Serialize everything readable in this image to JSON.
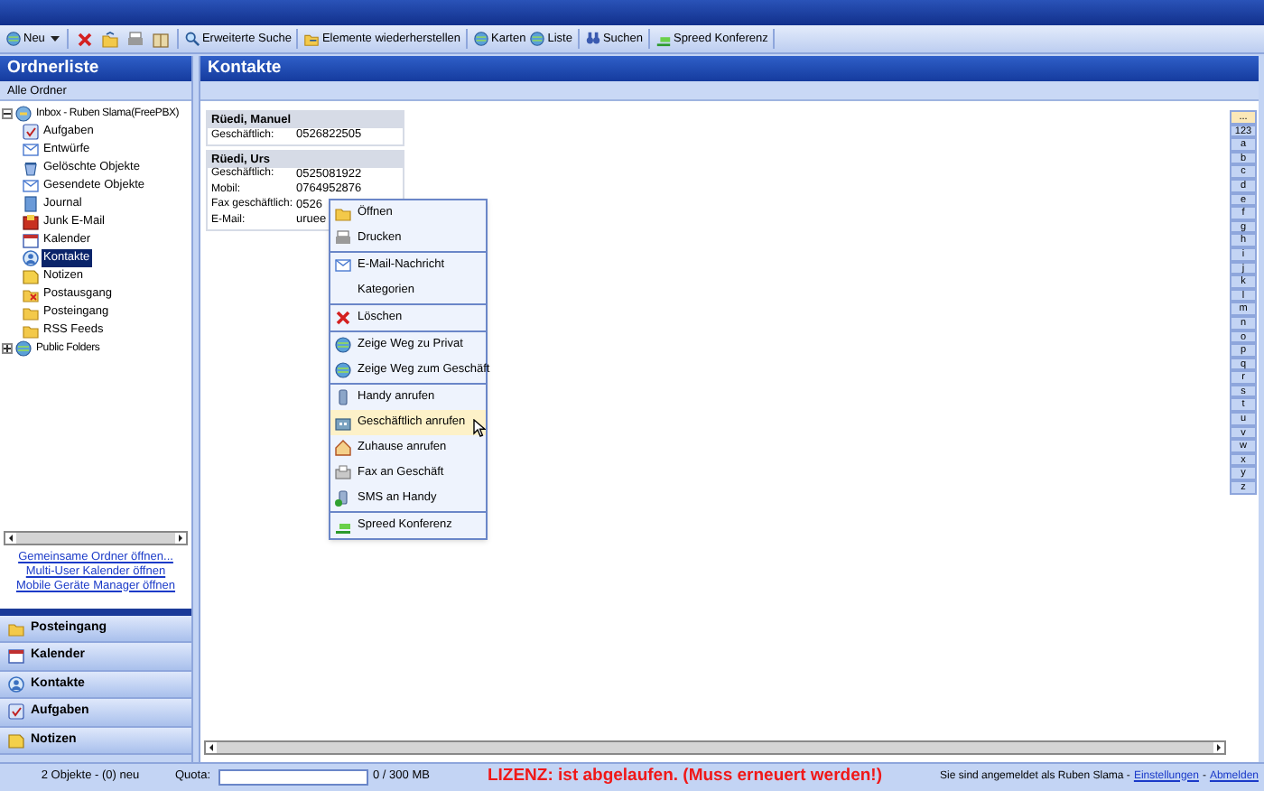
{
  "toolbar": {
    "groups": [
      [
        {
          "kind": "labeled",
          "label": "Neu"
        },
        {
          "kind": "caret"
        }
      ],
      [
        {
          "kind": "icon"
        },
        {
          "kind": "icon"
        },
        {
          "kind": "icon"
        },
        {
          "kind": "icon"
        }
      ],
      [
        {
          "kind": "labeled",
          "label": "Erweiterte Suche"
        }
      ],
      [
        {
          "kind": "labeled",
          "label": "Elemente wiederherstellen"
        }
      ],
      [
        {
          "kind": "labeled",
          "label": "Karten"
        },
        {
          "kind": "labeled",
          "label": "Liste"
        }
      ],
      [
        {
          "kind": "labeled",
          "label": "Suchen"
        }
      ],
      [
        {
          "kind": "labeled",
          "label": "Spreed Konferenz"
        }
      ]
    ]
  },
  "sidebar": {
    "title": "Ordnerliste",
    "subtitle": "Alle Ordner",
    "tree": [
      {
        "label": "Inbox - Ruben Slama(FreePBX)",
        "expanded": true,
        "selected": false,
        "children": [
          {
            "label": "Aufgaben",
            "selected": false
          },
          {
            "label": "Entwürfe",
            "selected": false
          },
          {
            "label": "Gelöschte Objekte",
            "selected": false
          },
          {
            "label": "Gesendete Objekte",
            "selected": false
          },
          {
            "label": "Journal",
            "selected": false
          },
          {
            "label": "Junk E-Mail",
            "selected": false
          },
          {
            "label": "Kalender",
            "selected": false
          },
          {
            "label": "Kontakte",
            "selected": true
          },
          {
            "label": "Notizen",
            "selected": false
          },
          {
            "label": "Postausgang",
            "selected": false
          },
          {
            "label": "Posteingang",
            "selected": false
          },
          {
            "label": "RSS Feeds",
            "selected": false
          }
        ]
      },
      {
        "label": "Public Folders",
        "expanded": false,
        "selected": false
      }
    ],
    "links": [
      "Gemeinsame Ordner öffnen...",
      "Multi-User Kalender öffnen",
      "Mobile Geräte Manager öffnen"
    ],
    "nav": [
      "Posteingang",
      "Kalender",
      "Kontakte",
      "Aufgaben",
      "Notizen"
    ]
  },
  "main": {
    "title": "Kontakte",
    "cards": [
      {
        "name": "Rüedi, Manuel",
        "fields": [
          {
            "label": "Geschäftlich:",
            "value": "0526822505"
          }
        ]
      },
      {
        "name": "Rüedi, Urs",
        "fields": [
          {
            "label": "Geschäftlich:",
            "value": "0525081922"
          },
          {
            "label": "Mobil:",
            "value": "0764952876"
          },
          {
            "label": "Fax geschäftlich:",
            "value": "0526"
          },
          {
            "label": "E-Mail:",
            "value": "uruee"
          }
        ]
      }
    ],
    "alphabet": [
      {
        "label": "...",
        "selected": true
      },
      {
        "label": "123",
        "selected": false
      },
      {
        "label": "a",
        "selected": false
      },
      {
        "label": "b",
        "selected": false
      },
      {
        "label": "c",
        "selected": false
      },
      {
        "label": "d",
        "selected": false
      },
      {
        "label": "e",
        "selected": false
      },
      {
        "label": "f",
        "selected": false
      },
      {
        "label": "g",
        "selected": false
      },
      {
        "label": "h",
        "selected": false
      },
      {
        "label": "i",
        "selected": false
      },
      {
        "label": "j",
        "selected": false
      },
      {
        "label": "k",
        "selected": false
      },
      {
        "label": "l",
        "selected": false
      },
      {
        "label": "m",
        "selected": false
      },
      {
        "label": "n",
        "selected": false
      },
      {
        "label": "o",
        "selected": false
      },
      {
        "label": "p",
        "selected": false
      },
      {
        "label": "q",
        "selected": false
      },
      {
        "label": "r",
        "selected": false
      },
      {
        "label": "s",
        "selected": false
      },
      {
        "label": "t",
        "selected": false
      },
      {
        "label": "u",
        "selected": false
      },
      {
        "label": "v",
        "selected": false
      },
      {
        "label": "w",
        "selected": false
      },
      {
        "label": "x",
        "selected": false
      },
      {
        "label": "y",
        "selected": false
      },
      {
        "label": "z",
        "selected": false
      }
    ]
  },
  "context_menu": {
    "groups": [
      [
        {
          "label": "Öffnen",
          "selected": false
        },
        {
          "label": "Drucken",
          "selected": false
        }
      ],
      [
        {
          "label": "E-Mail-Nachricht",
          "selected": false
        },
        {
          "label": "Kategorien",
          "selected": false
        }
      ],
      [
        {
          "label": "Löschen",
          "selected": false
        }
      ],
      [
        {
          "label": "Zeige Weg zu Privat",
          "selected": false
        },
        {
          "label": "Zeige Weg zum Geschäft",
          "selected": false
        }
      ],
      [
        {
          "label": "Handy anrufen",
          "selected": false
        },
        {
          "label": "Geschäftlich anrufen",
          "selected": true
        },
        {
          "label": "Zuhause anrufen",
          "selected": false
        },
        {
          "label": "Fax an Geschäft",
          "selected": false
        },
        {
          "label": "SMS an Handy",
          "selected": false
        }
      ],
      [
        {
          "label": "Spreed Konferenz",
          "selected": false
        }
      ]
    ]
  },
  "status_bar": {
    "count": "2 Objekte - (0) neu",
    "quota_label": "Quota:",
    "quota_usage": "0 / 300 MB",
    "license_warning": "LIZENZ: ist abgelaufen. (Muss erneuert werden!)",
    "session": [
      {
        "kind": "text",
        "text": "Sie sind angemeldet als Ruben Slama -"
      },
      {
        "kind": "link",
        "text": "Einstellungen"
      },
      {
        "kind": "text",
        "text": "-"
      },
      {
        "kind": "link",
        "text": "Abmelden"
      }
    ]
  }
}
